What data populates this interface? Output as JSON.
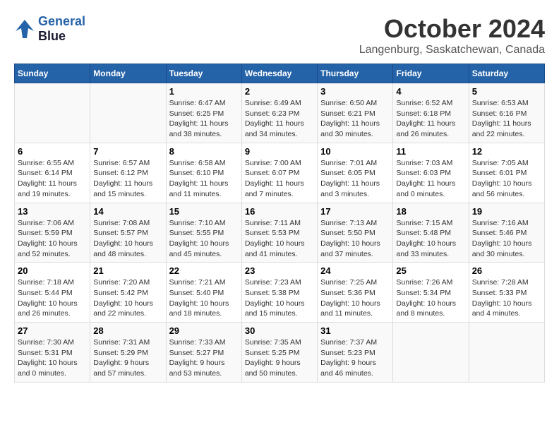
{
  "logo": {
    "line1": "General",
    "line2": "Blue"
  },
  "title": "October 2024",
  "location": "Langenburg, Saskatchewan, Canada",
  "days_of_week": [
    "Sunday",
    "Monday",
    "Tuesday",
    "Wednesday",
    "Thursday",
    "Friday",
    "Saturday"
  ],
  "weeks": [
    [
      {
        "num": "",
        "info": ""
      },
      {
        "num": "",
        "info": ""
      },
      {
        "num": "1",
        "info": "Sunrise: 6:47 AM\nSunset: 6:25 PM\nDaylight: 11 hours and 38 minutes."
      },
      {
        "num": "2",
        "info": "Sunrise: 6:49 AM\nSunset: 6:23 PM\nDaylight: 11 hours and 34 minutes."
      },
      {
        "num": "3",
        "info": "Sunrise: 6:50 AM\nSunset: 6:21 PM\nDaylight: 11 hours and 30 minutes."
      },
      {
        "num": "4",
        "info": "Sunrise: 6:52 AM\nSunset: 6:18 PM\nDaylight: 11 hours and 26 minutes."
      },
      {
        "num": "5",
        "info": "Sunrise: 6:53 AM\nSunset: 6:16 PM\nDaylight: 11 hours and 22 minutes."
      }
    ],
    [
      {
        "num": "6",
        "info": "Sunrise: 6:55 AM\nSunset: 6:14 PM\nDaylight: 11 hours and 19 minutes."
      },
      {
        "num": "7",
        "info": "Sunrise: 6:57 AM\nSunset: 6:12 PM\nDaylight: 11 hours and 15 minutes."
      },
      {
        "num": "8",
        "info": "Sunrise: 6:58 AM\nSunset: 6:10 PM\nDaylight: 11 hours and 11 minutes."
      },
      {
        "num": "9",
        "info": "Sunrise: 7:00 AM\nSunset: 6:07 PM\nDaylight: 11 hours and 7 minutes."
      },
      {
        "num": "10",
        "info": "Sunrise: 7:01 AM\nSunset: 6:05 PM\nDaylight: 11 hours and 3 minutes."
      },
      {
        "num": "11",
        "info": "Sunrise: 7:03 AM\nSunset: 6:03 PM\nDaylight: 11 hours and 0 minutes."
      },
      {
        "num": "12",
        "info": "Sunrise: 7:05 AM\nSunset: 6:01 PM\nDaylight: 10 hours and 56 minutes."
      }
    ],
    [
      {
        "num": "13",
        "info": "Sunrise: 7:06 AM\nSunset: 5:59 PM\nDaylight: 10 hours and 52 minutes."
      },
      {
        "num": "14",
        "info": "Sunrise: 7:08 AM\nSunset: 5:57 PM\nDaylight: 10 hours and 48 minutes."
      },
      {
        "num": "15",
        "info": "Sunrise: 7:10 AM\nSunset: 5:55 PM\nDaylight: 10 hours and 45 minutes."
      },
      {
        "num": "16",
        "info": "Sunrise: 7:11 AM\nSunset: 5:53 PM\nDaylight: 10 hours and 41 minutes."
      },
      {
        "num": "17",
        "info": "Sunrise: 7:13 AM\nSunset: 5:50 PM\nDaylight: 10 hours and 37 minutes."
      },
      {
        "num": "18",
        "info": "Sunrise: 7:15 AM\nSunset: 5:48 PM\nDaylight: 10 hours and 33 minutes."
      },
      {
        "num": "19",
        "info": "Sunrise: 7:16 AM\nSunset: 5:46 PM\nDaylight: 10 hours and 30 minutes."
      }
    ],
    [
      {
        "num": "20",
        "info": "Sunrise: 7:18 AM\nSunset: 5:44 PM\nDaylight: 10 hours and 26 minutes."
      },
      {
        "num": "21",
        "info": "Sunrise: 7:20 AM\nSunset: 5:42 PM\nDaylight: 10 hours and 22 minutes."
      },
      {
        "num": "22",
        "info": "Sunrise: 7:21 AM\nSunset: 5:40 PM\nDaylight: 10 hours and 18 minutes."
      },
      {
        "num": "23",
        "info": "Sunrise: 7:23 AM\nSunset: 5:38 PM\nDaylight: 10 hours and 15 minutes."
      },
      {
        "num": "24",
        "info": "Sunrise: 7:25 AM\nSunset: 5:36 PM\nDaylight: 10 hours and 11 minutes."
      },
      {
        "num": "25",
        "info": "Sunrise: 7:26 AM\nSunset: 5:34 PM\nDaylight: 10 hours and 8 minutes."
      },
      {
        "num": "26",
        "info": "Sunrise: 7:28 AM\nSunset: 5:33 PM\nDaylight: 10 hours and 4 minutes."
      }
    ],
    [
      {
        "num": "27",
        "info": "Sunrise: 7:30 AM\nSunset: 5:31 PM\nDaylight: 10 hours and 0 minutes."
      },
      {
        "num": "28",
        "info": "Sunrise: 7:31 AM\nSunset: 5:29 PM\nDaylight: 9 hours and 57 minutes."
      },
      {
        "num": "29",
        "info": "Sunrise: 7:33 AM\nSunset: 5:27 PM\nDaylight: 9 hours and 53 minutes."
      },
      {
        "num": "30",
        "info": "Sunrise: 7:35 AM\nSunset: 5:25 PM\nDaylight: 9 hours and 50 minutes."
      },
      {
        "num": "31",
        "info": "Sunrise: 7:37 AM\nSunset: 5:23 PM\nDaylight: 9 hours and 46 minutes."
      },
      {
        "num": "",
        "info": ""
      },
      {
        "num": "",
        "info": ""
      }
    ]
  ]
}
